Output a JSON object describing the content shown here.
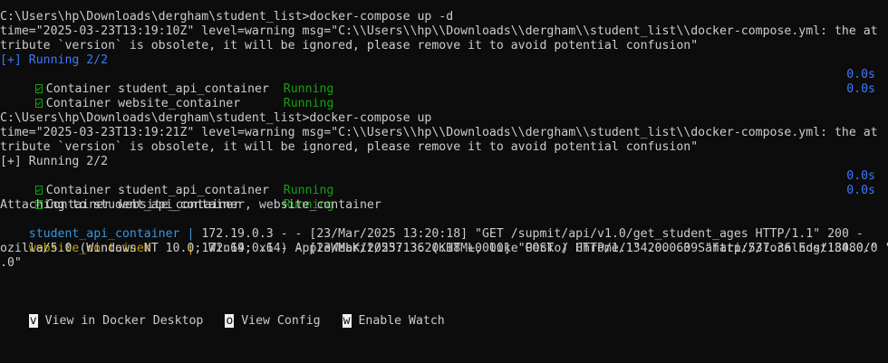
{
  "commands": {
    "first": "C:\\Users\\hp\\Downloads\\dergham\\student_list>docker-compose up -d",
    "second": "C:\\Users\\hp\\Downloads\\dergham\\student_list>docker-compose up"
  },
  "warnings": {
    "first_line1": "time=\"2025-03-23T13:19:10Z\" level=warning msg=\"C:\\\\Users\\\\hp\\\\Downloads\\\\dergham\\\\student_list\\\\docker-compose.yml: the at",
    "first_line2": "tribute `version` is obsolete, it will be ignored, please remove it to avoid potential confusion\"",
    "second_line1": "time=\"2025-03-23T13:19:21Z\" level=warning msg=\"C:\\\\Users\\\\hp\\\\Downloads\\\\dergham\\\\student_list\\\\docker-compose.yml: the at",
    "second_line2": "tribute `version` is obsolete, it will be ignored, please remove it to avoid potential confusion\""
  },
  "status": {
    "header": "[+] Running 2/2",
    "containers": [
      {
        "name": "Container student_api_container",
        "state": "Running",
        "time": "0.0s"
      },
      {
        "name": "Container website_container",
        "state": "Running",
        "time": "0.0s"
      }
    ]
  },
  "attaching": "Attaching to student_api_container, website_container",
  "logs": [
    {
      "prefix": "student_api_container ",
      "sep": "|",
      "text": " 172.19.0.3 - - [23/Mar/2025 13:20:18] \"GET /supmit/api/v1.0/get_student_ages HTTP/1.1\" 200 -"
    },
    {
      "prefix": "website_container     ",
      "sep": "|",
      "text": " 172.19.0.1 - - [23/Mar/2025:13:20:18 +0000] \"POST / HTTP/1.1\" 200 639 \"http://localhost:8080/\" \"M"
    }
  ],
  "log_wrap_1": "ozilla/5.0 (Windows NT 10.0; Win64; x64) AppleWebKit/537.36 (KHTML, like Gecko) Chrome/134.0.0.0 Safari/537.36 Edg/134.0.0",
  "log_wrap_2": ".0\"",
  "menu": [
    {
      "key": "v",
      "label": " View in Docker Desktop"
    },
    {
      "key": "o",
      "label": " View Config"
    },
    {
      "key": "w",
      "label": " Enable Watch"
    }
  ],
  "colors": {
    "background": "#0c0c0c",
    "text": "#cccccc",
    "blue": "#3b78ff",
    "green": "#13a10e",
    "cyan": "#3a96dd",
    "yellow": "#c19c00"
  }
}
